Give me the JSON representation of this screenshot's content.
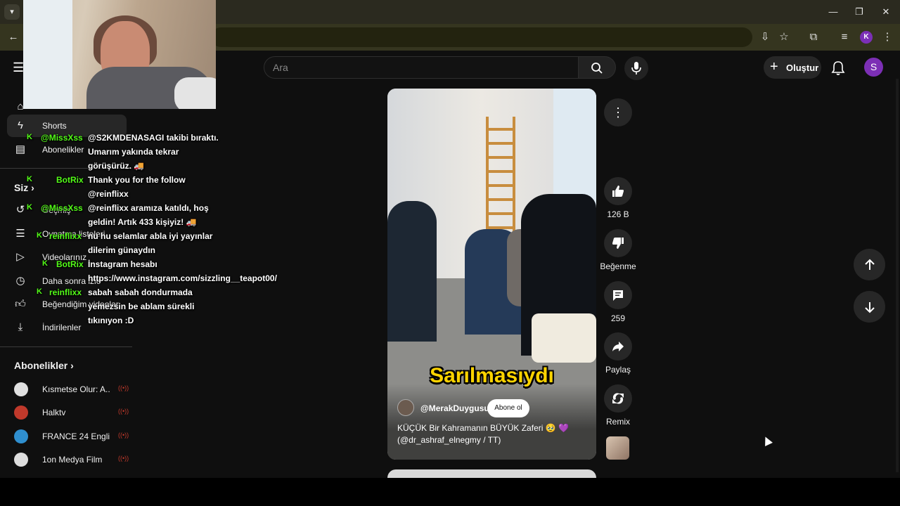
{
  "masthead": {
    "search_placeholder": "Ara",
    "create_label": "Oluştur",
    "avatar_letter": "S",
    "profile_letter": "K"
  },
  "sidebar": {
    "items": [
      {
        "label": "Shorts",
        "icon": "shorts-icon"
      },
      {
        "label": "Abonelikler",
        "icon": "subscriptions-icon"
      }
    ],
    "you_title": "Siz",
    "you_items": [
      {
        "label": "Geçmiş",
        "icon": "history-icon"
      },
      {
        "label": "Oynatma listeleri",
        "icon": "playlist-icon"
      },
      {
        "label": "Videolarınız",
        "icon": "your-videos-icon"
      },
      {
        "label": "Daha sonra izle",
        "icon": "watch-later-icon"
      },
      {
        "label": "Beğendiğim videolar",
        "icon": "like-icon"
      },
      {
        "label": "İndirilenler",
        "icon": "download-icon"
      }
    ],
    "subs_title": "Abonelikler",
    "subscriptions": [
      {
        "name": "Kısmetse Olur: A...",
        "color": "#e0e0e0"
      },
      {
        "name": "Halktv",
        "color": "#c0392b"
      },
      {
        "name": "FRANCE 24 Engli...",
        "color": "#2f8fcf"
      },
      {
        "name": "1on Medya Film",
        "color": "#dddddd"
      }
    ]
  },
  "chat": [
    {
      "user": "@MissXss",
      "msg": "@S2KMDENASAGI takibi bıraktı. Umarım yakında tekrar görüşürüz. 🚚"
    },
    {
      "user": "BotRix",
      "msg": "Thank you for the follow @reinflixx"
    },
    {
      "user": "@MissXss",
      "msg": "@reinflixx aramıza katıldı, hoş geldin! Artık 433 kişiyiz! 🚚"
    },
    {
      "user": "reinflixx",
      "msg": "nu hu selamlar abla iyi yayınlar dilerim günaydın"
    },
    {
      "user": "BotRix",
      "msg": "İnstagram hesabı https://www.instagram.com/sizzling__teapot00/"
    },
    {
      "user": "reinflixx",
      "msg": "sabah sabah dondurmada yemezsin be ablam sürekli tıkınıyon :D"
    }
  ],
  "short": {
    "caption": "Sarılmasıydı",
    "channel": "@MerakDuygusu",
    "subscribe_label": "Abone ol",
    "title": "KÜÇÜK Bir Kahramanın BÜYÜK Zaferi 🥹 💜 (@dr_ashraf_elnegmy / TT)"
  },
  "actions": {
    "like_count": "126 B",
    "dislike_label": "Beğenme",
    "comment_count": "259",
    "share_label": "Paylaş",
    "remix_label": "Remix"
  },
  "colors": {
    "accent_green": "#53fc18",
    "caption_yellow": "#ffd400",
    "avatar_purple": "#7c2fb5"
  }
}
